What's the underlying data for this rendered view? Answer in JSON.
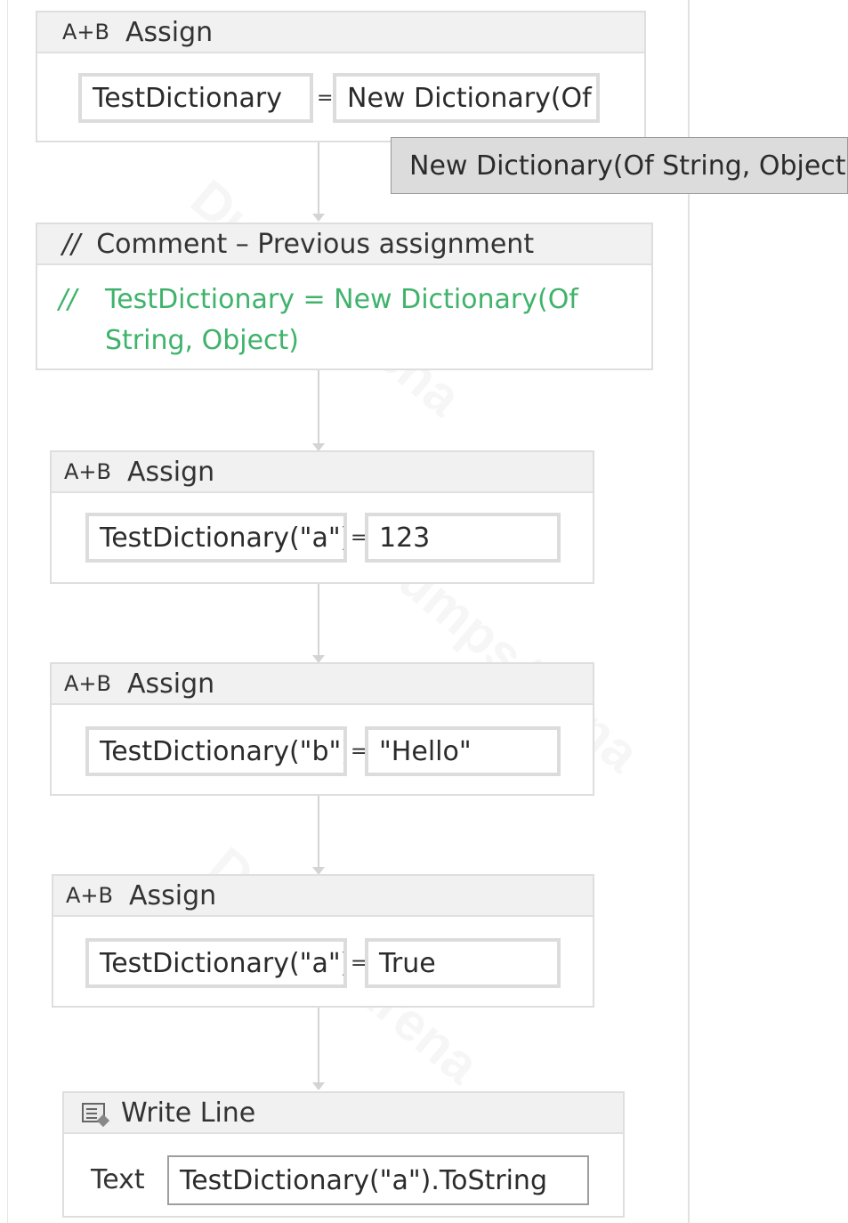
{
  "assign1": {
    "icon": "A+B",
    "title": "Assign",
    "to": "TestDictionary",
    "equals": "=",
    "value": "New Dictionary(Of"
  },
  "tooltip": {
    "text": "New Dictionary(Of String, Object)"
  },
  "comment": {
    "icon": "//",
    "title": "Comment – Previous assignment",
    "slashes": "//",
    "line1": "TestDictionary = New Dictionary(Of",
    "line2": "String, Object)"
  },
  "assign2": {
    "icon": "A+B",
    "title": "Assign",
    "to": "TestDictionary(\"a\")",
    "equals": "=",
    "value": "123"
  },
  "assign3": {
    "icon": "A+B",
    "title": "Assign",
    "to": "TestDictionary(\"b\")",
    "equals": "=",
    "value": "\"Hello\""
  },
  "assign4": {
    "icon": "A+B",
    "title": "Assign",
    "to": "TestDictionary(\"a\")",
    "equals": "=",
    "value": "True"
  },
  "writeline": {
    "icon": "write-line-icon",
    "title": "Write Line",
    "text_label": "Text",
    "text_value": "TestDictionary(\"a\").ToString"
  },
  "watermark": "DumpsArena",
  "colors": {
    "comment_text": "#3fb36b",
    "header_bg": "#f1f1f1",
    "border": "#dedede",
    "tooltip_bg": "#dcdcdc"
  }
}
